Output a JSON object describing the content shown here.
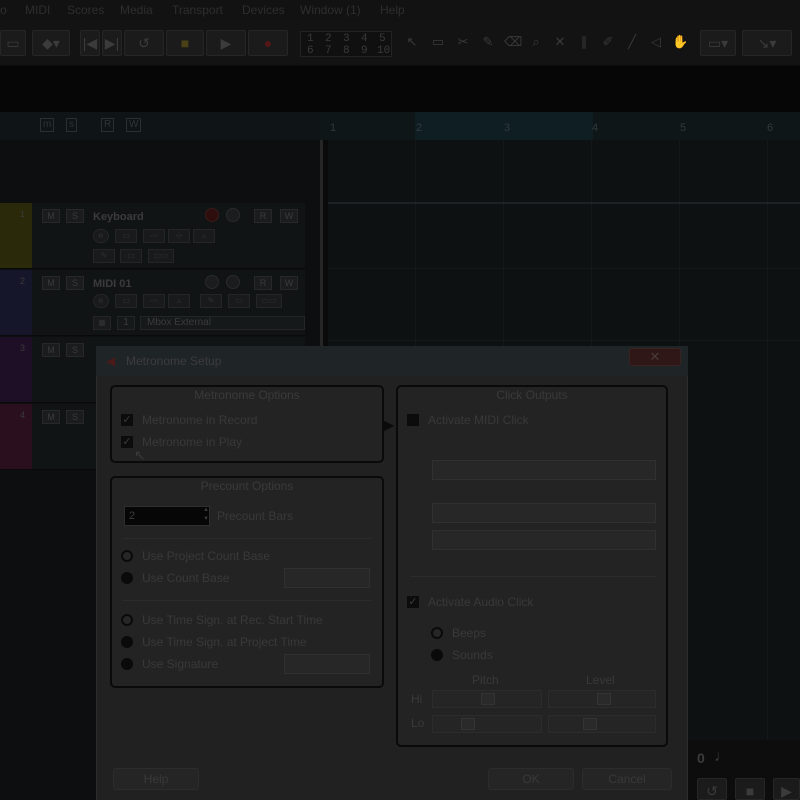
{
  "menu": [
    "o",
    "MIDI",
    "Scores",
    "Media",
    "Transport",
    "Devices",
    "Window (1)",
    "Help"
  ],
  "toolbar": {
    "locator_numbers": [
      "1",
      "2",
      "3",
      "4",
      "5",
      "6",
      "7",
      "8",
      "9",
      "10"
    ]
  },
  "track_header": {
    "chips": [
      "m",
      "s",
      "R",
      "W"
    ]
  },
  "ruler": {
    "bars": [
      "1",
      "2",
      "3",
      "4",
      "5",
      "6"
    ]
  },
  "tracks": [
    {
      "number": "1",
      "name": "Keyboard",
      "color": "#2a2a0a",
      "m": "M",
      "s": "S",
      "r": "R",
      "w": "W"
    },
    {
      "number": "2",
      "name": "MIDI 01",
      "color": "#16162a",
      "m": "M",
      "s": "S",
      "r": "R",
      "w": "W",
      "channel": "1",
      "output": "Mbox External"
    },
    {
      "number": "3",
      "color": "#1e0f26",
      "m": "M",
      "s": "S"
    },
    {
      "number": "4",
      "color": "#2a0f1e",
      "m": "M",
      "s": "S"
    }
  ],
  "dialog": {
    "title": "Metronome Setup",
    "close_glyph": "✕",
    "metronome_options": {
      "title": "Metronome Options",
      "record_label": "Metronome in Record",
      "play_label": "Metronome in Play"
    },
    "precount_options": {
      "title": "Precount Options",
      "bars_value": "2",
      "bars_label": "Precount Bars",
      "use_project_count_base": "Use Project Count Base",
      "use_count_base": "Use Count Base",
      "use_time_sign_rec_start": "Use Time Sign. at Rec. Start Time",
      "use_time_sign_project": "Use Time Sign. at Project Time",
      "use_signature": "Use Signature"
    },
    "click_outputs": {
      "title": "Click Outputs",
      "activate_midi_click": "Activate MIDI Click",
      "activate_audio_click": "Activate Audio Click",
      "beeps": "Beeps",
      "sounds": "Sounds",
      "pitch": "Pitch",
      "level": "Level",
      "hi": "Hi",
      "lo": "Lo"
    },
    "buttons": {
      "help": "Help",
      "ok": "OK",
      "cancel": "Cancel"
    }
  },
  "mini_transport": {
    "count": "0"
  }
}
